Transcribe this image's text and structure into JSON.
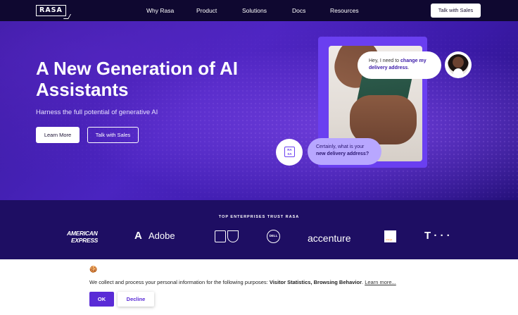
{
  "nav": {
    "logo": "RASA",
    "items": [
      {
        "label": "Why Rasa"
      },
      {
        "label": "Product"
      },
      {
        "label": "Solutions"
      },
      {
        "label": "Docs"
      },
      {
        "label": "Resources"
      }
    ],
    "cta_label": "Talk with Sales"
  },
  "hero": {
    "title": "A New Generation of AI Assistants",
    "subtitle": "Harness the full potential of generative AI",
    "learn_more_label": "Learn More",
    "talk_sales_label": "Talk with Sales"
  },
  "chat": {
    "user_message_prefix": "Hey, I need to",
    "user_message_bold": "change my delivery address",
    "user_message_suffix": ".",
    "bot_message_prefix": "Certainly, what is your",
    "bot_message_bold": "new delivery address?",
    "bot_badge_text": "RA SA"
  },
  "trust": {
    "title": "TOP ENTERPRISES TRUST RASA",
    "brands": {
      "amex_line1": "AMERICAN",
      "amex_line2": "EXPRESS",
      "adobe_mark": "A",
      "adobe": "Adobe",
      "dell": "DELL",
      "accenture": "accenture",
      "orange": "orange",
      "tmobile": "T · · ·"
    }
  },
  "cookie": {
    "icon": "🍪",
    "text_prefix": "We collect and process your personal information for the following purposes:",
    "text_bold": "Visitor Statistics, Browsing Behavior",
    "text_suffix": ".",
    "link_label": "Learn more...",
    "ok_label": "OK",
    "decline_label": "Decline"
  },
  "colors": {
    "brand_purple": "#5a2bd6",
    "nav_bg": "#0f0830",
    "strip_bg": "#1e0e63"
  }
}
